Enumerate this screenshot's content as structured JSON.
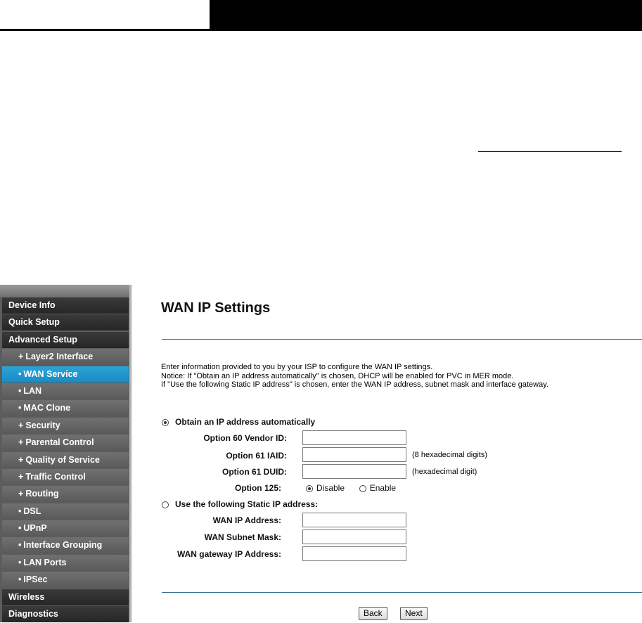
{
  "sidebar": {
    "items": [
      {
        "label": "Device Info",
        "type": "top"
      },
      {
        "label": "Quick Setup",
        "type": "top"
      },
      {
        "label": "Advanced Setup",
        "type": "top"
      },
      {
        "label": "Layer2 Interface",
        "type": "sub",
        "bullet": "+"
      },
      {
        "label": "WAN Service",
        "type": "sub",
        "bullet": "•",
        "active": true
      },
      {
        "label": "LAN",
        "type": "sub",
        "bullet": "•"
      },
      {
        "label": "MAC Clone",
        "type": "sub",
        "bullet": "•"
      },
      {
        "label": "Security",
        "type": "sub",
        "bullet": "+"
      },
      {
        "label": "Parental Control",
        "type": "sub",
        "bullet": "+"
      },
      {
        "label": "Quality of Service",
        "type": "sub",
        "bullet": "+"
      },
      {
        "label": "Traffic Control",
        "type": "sub",
        "bullet": "+"
      },
      {
        "label": "Routing",
        "type": "sub",
        "bullet": "+"
      },
      {
        "label": "DSL",
        "type": "sub",
        "bullet": "•"
      },
      {
        "label": "UPnP",
        "type": "sub",
        "bullet": "•"
      },
      {
        "label": "Interface Grouping",
        "type": "sub",
        "bullet": "•"
      },
      {
        "label": "LAN Ports",
        "type": "sub",
        "bullet": "•"
      },
      {
        "label": "IPSec",
        "type": "sub",
        "bullet": "•"
      },
      {
        "label": "Wireless",
        "type": "top"
      },
      {
        "label": "Diagnostics",
        "type": "top"
      }
    ]
  },
  "main": {
    "title": "WAN IP Settings",
    "description": [
      "Enter information provided to you by your ISP to configure the WAN IP settings.",
      "Notice: If \"Obtain an IP address automatically\" is chosen, DHCP will be enabled for PVC in MER mode.",
      "If \"Use the following Static IP address\" is chosen, enter the WAN IP address, subnet mask and interface gateway."
    ],
    "auto": {
      "label": "Obtain an IP address automatically",
      "option60_label": "Option 60 Vendor ID:",
      "option60_value": "",
      "option61_iaid_label": "Option 61 IAID:",
      "option61_iaid_value": "",
      "option61_iaid_hint": "(8 hexadecimal digits)",
      "option61_duid_label": "Option 61 DUID:",
      "option61_duid_value": "",
      "option61_duid_hint": "(hexadecimal digit)",
      "option125_label": "Option 125:",
      "option125_disable": "Disable",
      "option125_enable": "Enable"
    },
    "static": {
      "label": "Use the following Static IP address:",
      "ip_label": "WAN IP Address:",
      "ip_value": "",
      "mask_label": "WAN Subnet Mask:",
      "mask_value": "",
      "gateway_label": "WAN gateway IP Address:",
      "gateway_value": ""
    },
    "buttons": {
      "back": "Back",
      "next": "Next"
    }
  }
}
